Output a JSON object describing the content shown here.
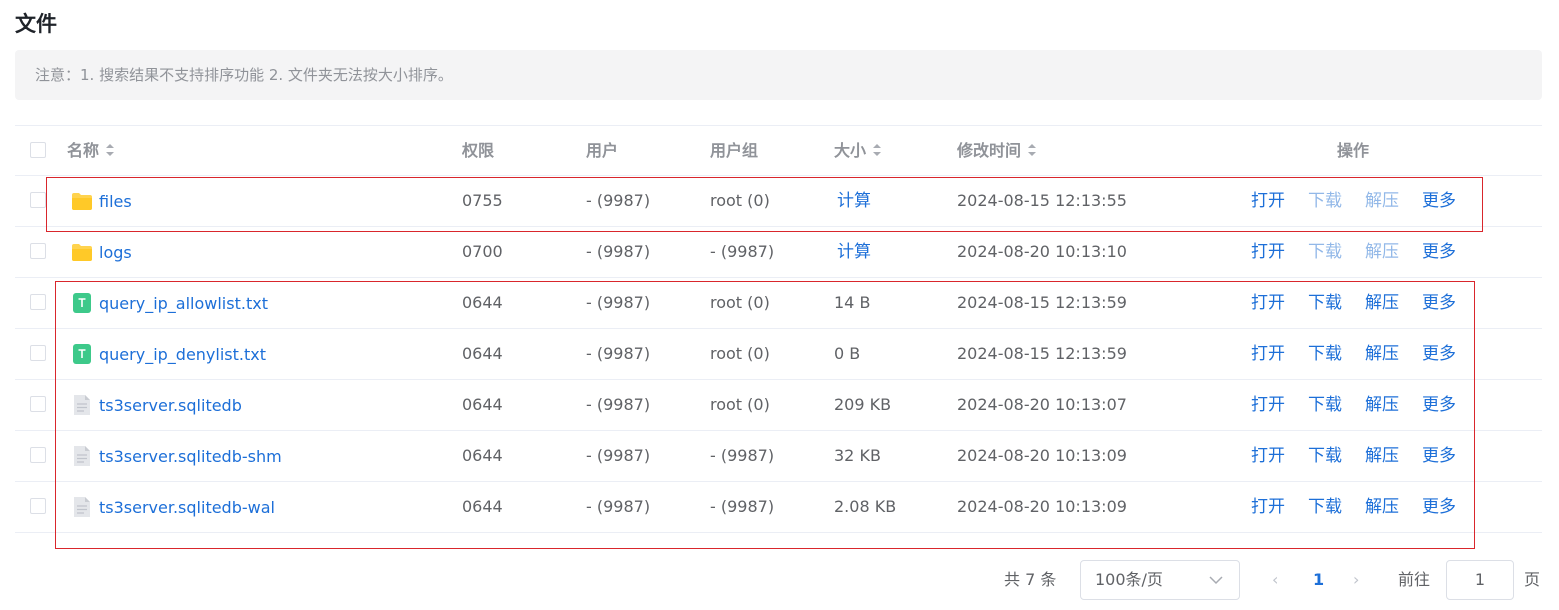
{
  "page_title": "文件",
  "notice": "注意：1. 搜索结果不支持排序功能 2. 文件夹无法按大小排序。",
  "columns": {
    "name": "名称",
    "perm": "权限",
    "user": "用户",
    "group": "用户组",
    "size": "大小",
    "mtime": "修改时间",
    "ops": "操作"
  },
  "ops_labels": {
    "open": "打开",
    "download": "下载",
    "extract": "解压",
    "more": "更多"
  },
  "rows": [
    {
      "name": "files",
      "icon": "folder-icon",
      "perm": "0755",
      "user": "- (9987)",
      "group": "root (0)",
      "size": "计算",
      "mtime": "2024-08-15 12:13:55"
    },
    {
      "name": "logs",
      "icon": "folder-icon",
      "perm": "0700",
      "user": "- (9987)",
      "group": "- (9987)",
      "size": "计算",
      "mtime": "2024-08-20 10:13:10"
    },
    {
      "name": "query_ip_allowlist.txt",
      "icon": "text-file-icon",
      "perm": "0644",
      "user": "- (9987)",
      "group": "root (0)",
      "size": "14 B",
      "mtime": "2024-08-15 12:13:59"
    },
    {
      "name": "query_ip_denylist.txt",
      "icon": "text-file-icon",
      "perm": "0644",
      "user": "- (9987)",
      "group": "root (0)",
      "size": "0 B",
      "mtime": "2024-08-15 12:13:59"
    },
    {
      "name": "ts3server.sqlitedb",
      "icon": "generic-file-icon",
      "perm": "0644",
      "user": "- (9987)",
      "group": "root (0)",
      "size": "209 KB",
      "mtime": "2024-08-20 10:13:07"
    },
    {
      "name": "ts3server.sqlitedb-shm",
      "icon": "generic-file-icon",
      "perm": "0644",
      "user": "- (9987)",
      "group": "- (9987)",
      "size": "32 KB",
      "mtime": "2024-08-20 10:13:09"
    },
    {
      "name": "ts3server.sqlitedb-wal",
      "icon": "generic-file-icon",
      "perm": "0644",
      "user": "- (9987)",
      "group": "- (9987)",
      "size": "2.08 KB",
      "mtime": "2024-08-20 10:13:09"
    }
  ],
  "pagination": {
    "total": "共 7 条",
    "page_size": "100条/页",
    "prev": "‹",
    "current": "1",
    "next": "›",
    "goto_label": "前往",
    "goto_value": "1",
    "page_suffix": "页"
  },
  "colors": {
    "link": "#1d6fd8",
    "link_disabled": "#92b8e8",
    "highlight_box": "#d9262c",
    "folder": "#ffd34e",
    "text_file": "#3dc98a"
  }
}
